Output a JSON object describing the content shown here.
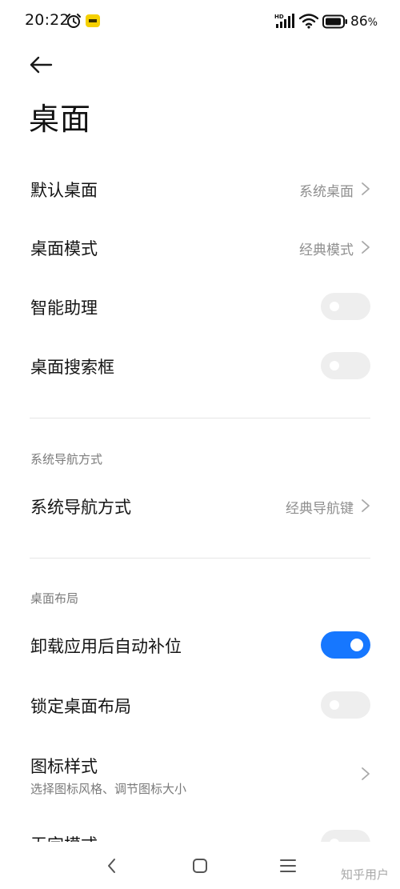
{
  "status_bar": {
    "time": "20:22",
    "battery": "86",
    "battery_unit": "%"
  },
  "header": {
    "title": "桌面"
  },
  "rows": {
    "default_launcher": {
      "label": "默认桌面",
      "value": "系统桌面"
    },
    "launcher_mode": {
      "label": "桌面模式",
      "value": "经典模式"
    },
    "smart_assistant": {
      "label": "智能助理",
      "enabled": false
    },
    "search_bar": {
      "label": "桌面搜索框",
      "enabled": false
    },
    "nav_mode": {
      "label": "系统导航方式",
      "value": "经典导航键"
    },
    "auto_fill": {
      "label": "卸载应用后自动补位",
      "enabled": true
    },
    "lock_layout": {
      "label": "锁定桌面布局",
      "enabled": false
    },
    "icon_style": {
      "label": "图标样式",
      "sub": "选择图标风格、调节图标大小"
    },
    "partial_mode": {
      "label": "无字模式",
      "enabled": false
    }
  },
  "sections": {
    "nav": "系统导航方式",
    "layout": "桌面布局"
  },
  "watermark": "知乎用户",
  "colors": {
    "accent": "#1677ff",
    "toggle_off": "#eeeeee",
    "secondary_text": "#8f8f8f"
  }
}
